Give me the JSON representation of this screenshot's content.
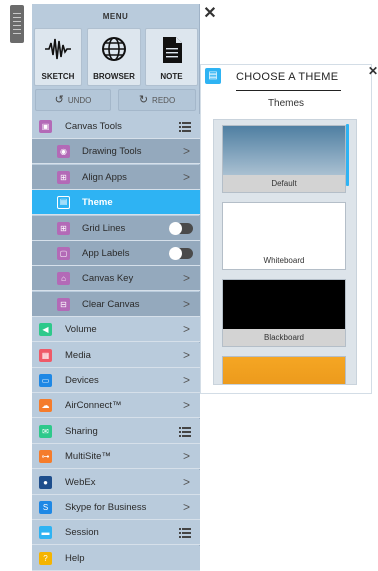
{
  "menu": {
    "title": "MENU",
    "close": "✕",
    "big_buttons": [
      {
        "label": "SKETCH",
        "icon": "sketch-waveform-icon"
      },
      {
        "label": "BROWSER",
        "icon": "globe-icon"
      },
      {
        "label": "NOTE",
        "icon": "document-icon"
      }
    ],
    "undo": "UNDO",
    "redo": "REDO",
    "rows": [
      {
        "label": "Canvas Tools",
        "kind": "top",
        "trailing": "lines",
        "icon_color": "#b36ab7"
      },
      {
        "label": "Drawing Tools",
        "kind": "sub",
        "trailing": "chevron",
        "icon_color": "#b36ab7"
      },
      {
        "label": "Align Apps",
        "kind": "sub",
        "trailing": "chevron",
        "icon_color": "#b36ab7"
      },
      {
        "label": "Theme",
        "kind": "selected",
        "trailing": "none",
        "icon_color": "#ffffff"
      },
      {
        "label": "Grid Lines",
        "kind": "sub",
        "trailing": "toggle",
        "icon_color": "#b36ab7"
      },
      {
        "label": "App Labels",
        "kind": "sub",
        "trailing": "toggle",
        "icon_color": "#b36ab7"
      },
      {
        "label": "Canvas Key",
        "kind": "sub",
        "trailing": "chevron",
        "icon_color": "#b36ab7"
      },
      {
        "label": "Clear Canvas",
        "kind": "sub",
        "trailing": "chevron",
        "icon_color": "#b36ab7"
      },
      {
        "label": "Volume",
        "kind": "top",
        "trailing": "chevron",
        "icon_color": "#2ec98b"
      },
      {
        "label": "Media",
        "kind": "top",
        "trailing": "chevron",
        "icon_color": "#ef5a68"
      },
      {
        "label": "Devices",
        "kind": "top",
        "trailing": "chevron",
        "icon_color": "#1e88e5"
      },
      {
        "label": "AirConnect™",
        "kind": "top",
        "trailing": "chevron",
        "icon_color": "#f57c2b"
      },
      {
        "label": "Sharing",
        "kind": "top",
        "trailing": "lines",
        "icon_color": "#2ec98b"
      },
      {
        "label": "MultiSite™",
        "kind": "top",
        "trailing": "chevron",
        "icon_color": "#f57c2b"
      },
      {
        "label": "WebEx",
        "kind": "top",
        "trailing": "chevron",
        "icon_color": "#1e4e8c"
      },
      {
        "label": "Skype for Business",
        "kind": "top",
        "trailing": "chevron",
        "icon_color": "#1e88e5"
      },
      {
        "label": "Session",
        "kind": "top",
        "trailing": "lines",
        "icon_color": "#2eb3f3"
      },
      {
        "label": "Help",
        "kind": "top",
        "trailing": "none",
        "icon_color": "#f5b400"
      }
    ]
  },
  "theme_panel": {
    "title": "CHOOSE A THEME",
    "subtitle": "Themes",
    "close": "✕",
    "themes": [
      {
        "name": "Default",
        "colors": [
          "#4f7fa2",
          "#c9d7e2"
        ]
      },
      {
        "name": "Whiteboard",
        "colors": [
          "#ffffff",
          "#ffffff"
        ]
      },
      {
        "name": "Blackboard",
        "colors": [
          "#000000",
          "#000000"
        ]
      },
      {
        "name": "",
        "colors": [
          "#f5a623",
          "#e08a14"
        ]
      }
    ]
  },
  "colors": {
    "accent": "#2eb3f3",
    "menu_bg": "#b9cbdc",
    "submenu_bg": "#94a9bd"
  }
}
